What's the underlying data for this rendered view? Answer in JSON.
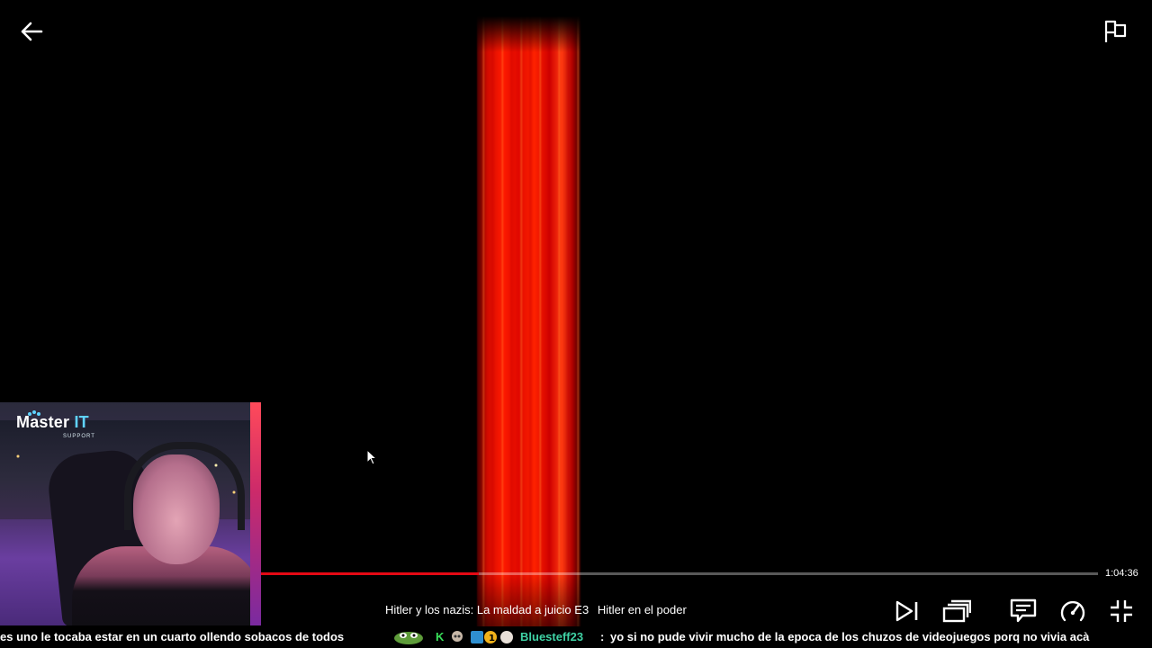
{
  "player": {
    "time_remaining": "1:04:36",
    "progress_fraction": 0.26,
    "show_title": "Hitler y los nazis: La maldad a juicio",
    "episode_code": "E3",
    "episode_name": "Hitler en el poder"
  },
  "icons": {
    "back": "back-arrow-icon",
    "report": "flag-icon",
    "next": "next-episode-icon",
    "episodes": "episodes-icon",
    "subtitles": "subtitles-icon",
    "speed": "playback-speed-icon",
    "fullscreen": "exit-fullscreen-icon"
  },
  "webcam": {
    "logo_main": "Master",
    "logo_accent": "IT",
    "logo_sub": "SUPPORT"
  },
  "chat": {
    "message_1": "es uno le tocaba estar en un cuarto ollendo sobacos de todos",
    "badge_letter": "K",
    "username": "Bluesteff23",
    "separator": ":",
    "message_2": "yo si no pude vivir mucho de la epoca de los chuzos de videojuegos porq no vivia acà"
  },
  "colors": {
    "accent_red": "#e50914",
    "chat_username": "#3fd3a5",
    "logo_accent": "#5fd3ff"
  }
}
